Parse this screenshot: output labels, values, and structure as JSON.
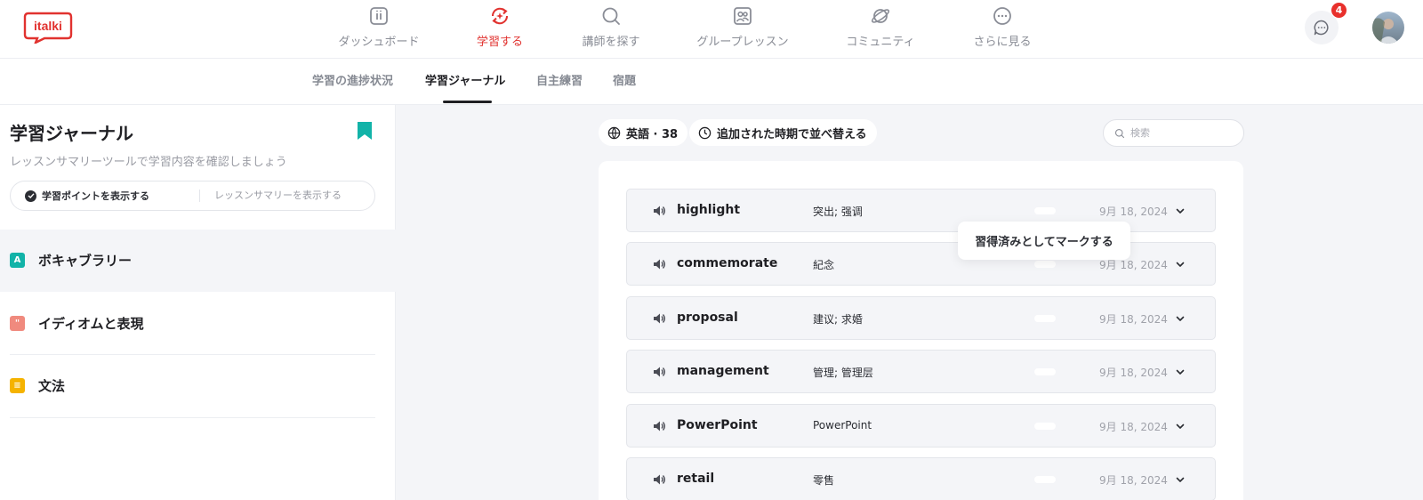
{
  "brand": {
    "logo_text": "italki",
    "accent": "#e1322f"
  },
  "nav": {
    "items": [
      {
        "label": "ダッシュボード",
        "icon": "dashboard-icon"
      },
      {
        "label": "学習する",
        "icon": "learn-icon",
        "active": true
      },
      {
        "label": "講師を探す",
        "icon": "search-icon"
      },
      {
        "label": "グループレッスン",
        "icon": "group-lesson-icon"
      },
      {
        "label": "コミュニティ",
        "icon": "community-planet-icon"
      },
      {
        "label": "さらに見る",
        "icon": "more-icon"
      }
    ],
    "chat_badge": "4"
  },
  "subnav": {
    "tabs": [
      {
        "label": "学習の進捗状況"
      },
      {
        "label": "学習ジャーナル",
        "active": true
      },
      {
        "label": "自主練習"
      },
      {
        "label": "宿題"
      }
    ]
  },
  "journal": {
    "title": "学習ジャーナル",
    "subtitle": "レッスンサマリーツールで学習内容を確認しましょう",
    "toggle": {
      "option1": "学習ポイントを表示する",
      "option2": "レッスンサマリーを表示する"
    },
    "categories": [
      {
        "label": "ボキャブラリー",
        "icon_text": "A",
        "color": "#12b3a8"
      },
      {
        "label": "イディオムと表現",
        "icon_text": "\"",
        "color": "#f08a7e"
      },
      {
        "label": "文法",
        "icon_text": "≡",
        "color": "#f5b300"
      }
    ]
  },
  "filters": {
    "language": "英語 · 38",
    "sort": "追加された時期で並べ替える",
    "search_placeholder": "検索"
  },
  "tooltip": "習得済みとしてマークする",
  "words": [
    {
      "word": "highlight",
      "translation": "突出; 强调",
      "date": "9月 18, 2024"
    },
    {
      "word": "commemorate",
      "translation": "紀念",
      "date": "9月 18, 2024"
    },
    {
      "word": "proposal",
      "translation": "建议; 求婚",
      "date": "9月 18, 2024"
    },
    {
      "word": "management",
      "translation": "管理; 管理层",
      "date": "9月 18, 2024"
    },
    {
      "word": "PowerPoint",
      "translation": "PowerPoint",
      "date": "9月 18, 2024"
    },
    {
      "word": "retail",
      "translation": "零售",
      "date": "9月 18, 2024"
    }
  ]
}
